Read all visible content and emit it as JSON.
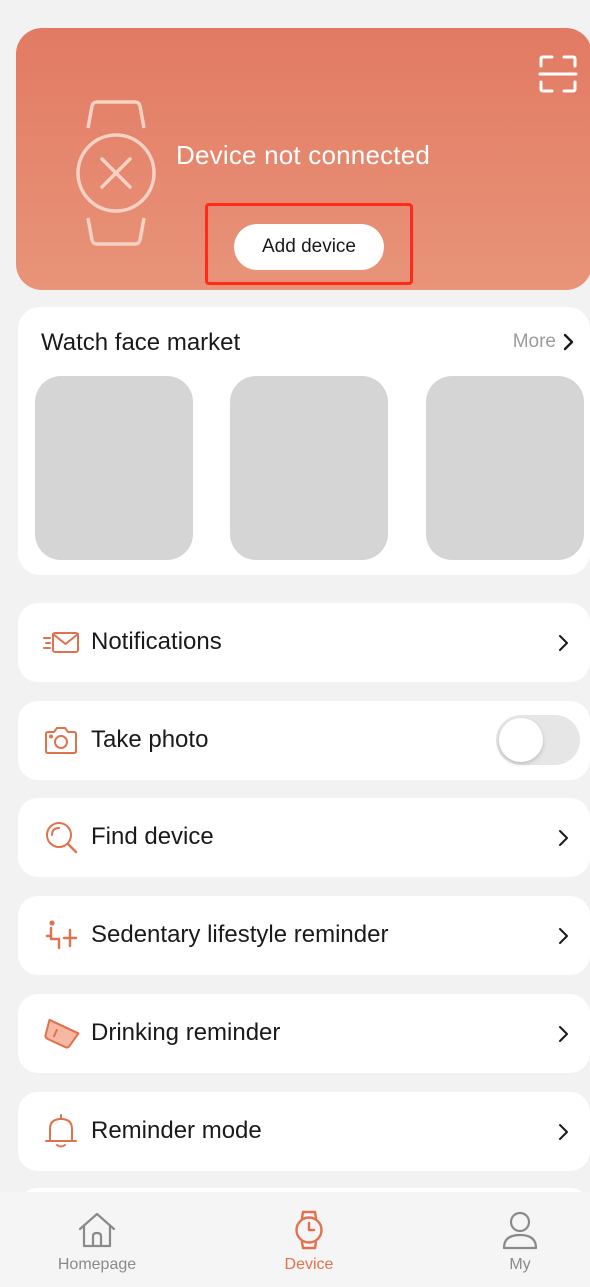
{
  "device_card": {
    "status": "Device not connected",
    "add_button": "Add device"
  },
  "market": {
    "title": "Watch face market",
    "more": "More"
  },
  "menu": [
    {
      "label": "Notifications",
      "icon": "envelope-icon",
      "control": "chevron"
    },
    {
      "label": "Take photo",
      "icon": "camera-icon",
      "control": "toggle",
      "toggle_on": false
    },
    {
      "label": "Find device",
      "icon": "magnifier-icon",
      "control": "chevron"
    },
    {
      "label": "Sedentary lifestyle reminder",
      "icon": "sitting-person-icon",
      "control": "chevron"
    },
    {
      "label": "Drinking reminder",
      "icon": "cup-icon",
      "control": "chevron"
    },
    {
      "label": "Reminder mode",
      "icon": "bell-icon",
      "control": "chevron"
    }
  ],
  "tabbar": [
    {
      "label": "Homepage",
      "icon": "home-icon",
      "active": false
    },
    {
      "label": "Device",
      "icon": "watch-icon",
      "active": true
    },
    {
      "label": "My",
      "icon": "person-icon",
      "active": false
    }
  ],
  "colors": {
    "accent": "#e2714d",
    "header_top": "#e27a63",
    "header_bottom": "#e89479",
    "highlight": "#ff2a1a"
  }
}
